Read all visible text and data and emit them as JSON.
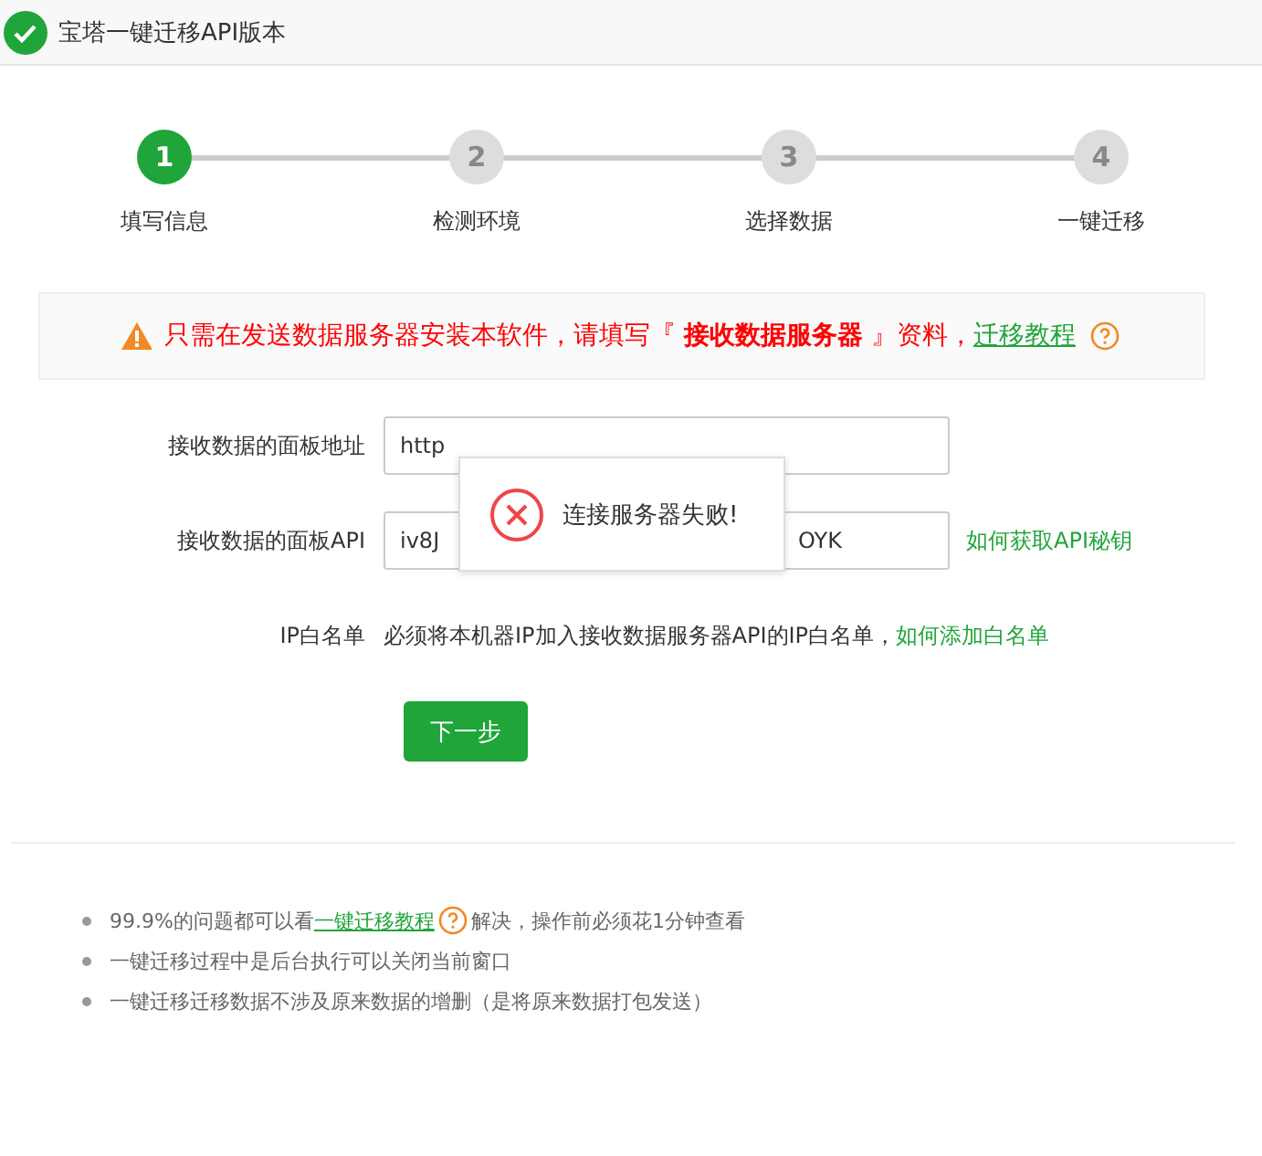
{
  "window": {
    "title": "宝塔一键迁移API版本"
  },
  "steps": [
    {
      "number": "1",
      "label": "填写信息",
      "selected": true
    },
    {
      "number": "2",
      "label": "检测环境",
      "selected": false
    },
    {
      "number": "3",
      "label": "选择数据",
      "selected": false
    },
    {
      "number": "4",
      "label": "一键迁移",
      "selected": false
    }
  ],
  "notice": {
    "text": "只需在发送数据服务器安装本软件，请填写『 **接收数据服务器** 』资料，",
    "link": "迁移教程"
  },
  "form": {
    "address": {
      "label": "接收数据的面板地址",
      "value_start": "http"
    },
    "api": {
      "label": "接收数据的面板API",
      "value_start": "iv8J",
      "value_end": "OYK",
      "link": "如何获取API秘钥"
    },
    "whitelist": {
      "label": "IP白名单",
      "text": "必须将本机器IP加入接收数据服务器API的IP白名单，",
      "link": "如何添加白名单"
    },
    "button": "下一步"
  },
  "toast": {
    "message": "连接服务器失败!"
  },
  "tips": [
    {
      "before": "99.9%的问题都可以看",
      "link": "一键迁移教程",
      "after": "解决，操作前必须花1分钟查看"
    },
    {
      "before": "一键迁移过程中是后台执行可以关闭当前窗口"
    },
    {
      "before": "一键迁移迁移数据不涉及原来数据的增删（是将原来数据打包发送）"
    }
  ]
}
